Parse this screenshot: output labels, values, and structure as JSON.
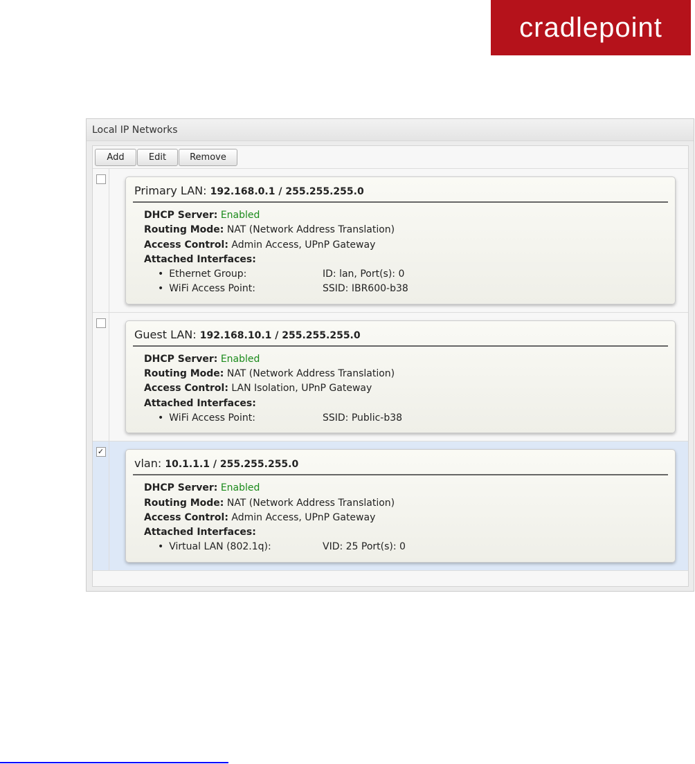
{
  "logo": "cradlepoint",
  "panel_title": "Local IP Networks",
  "toolbar": {
    "add": "Add",
    "edit": "Edit",
    "remove": "Remove"
  },
  "labels": {
    "dhcp": "DHCP Server:",
    "routing": "Routing Mode:",
    "access": "Access Control:",
    "attached": "Attached Interfaces:"
  },
  "networks": [
    {
      "name": "Primary LAN:",
      "addr": "192.168.0.1 / 255.255.255.0",
      "checked": false,
      "dhcp": "Enabled",
      "routing": "NAT (Network Address Translation)",
      "access": "Admin Access, UPnP Gateway",
      "interfaces": [
        {
          "name": "Ethernet Group:",
          "value": "ID: lan, Port(s): 0"
        },
        {
          "name": "WiFi Access Point:",
          "value": "SSID: IBR600-b38"
        }
      ]
    },
    {
      "name": "Guest LAN:",
      "addr": "192.168.10.1 / 255.255.255.0",
      "checked": false,
      "dhcp": "Enabled",
      "routing": "NAT (Network Address Translation)",
      "access": "LAN Isolation, UPnP Gateway",
      "interfaces": [
        {
          "name": "WiFi Access Point:",
          "value": "SSID: Public-b38"
        }
      ]
    },
    {
      "name": "vlan:",
      "addr": "10.1.1.1 / 255.255.255.0",
      "checked": true,
      "dhcp": "Enabled",
      "routing": "NAT (Network Address Translation)",
      "access": "Admin Access, UPnP Gateway",
      "interfaces": [
        {
          "name": "Virtual LAN (802.1q):",
          "value": "VID: 25 Port(s): 0"
        }
      ]
    }
  ],
  "checkmark": "✓"
}
